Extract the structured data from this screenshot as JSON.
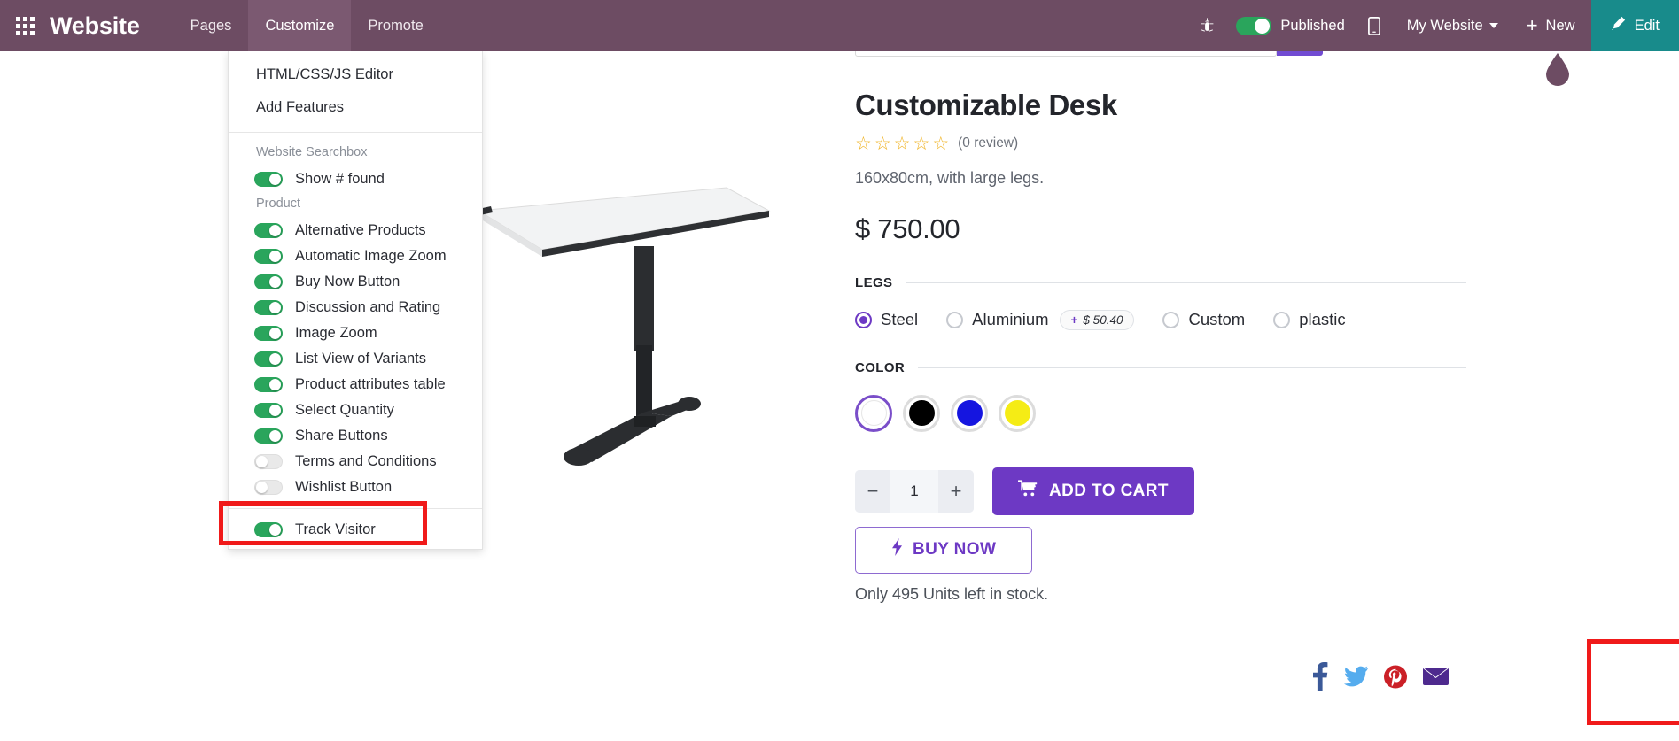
{
  "navbar": {
    "apps_icon": "apps-grid-icon",
    "brand": "Website",
    "items": [
      {
        "label": "Pages",
        "active": false
      },
      {
        "label": "Customize",
        "active": true
      },
      {
        "label": "Promote",
        "active": false
      }
    ],
    "bug_icon": "bug-icon",
    "publish": {
      "label": "Published",
      "state": "on",
      "color": "#2aa55c"
    },
    "mobile_icon": "mobile-preview-icon",
    "my_website": "My Website",
    "new_label": "New",
    "edit_label": "Edit",
    "bg_color": "#6d4c63",
    "edit_bg_color": "#188b8b"
  },
  "dropdown": {
    "links": [
      {
        "label": "HTML/CSS/JS Editor"
      },
      {
        "label": "Add Features"
      }
    ],
    "groups": [
      {
        "heading": "Website Searchbox",
        "options": [
          {
            "label": "Show # found",
            "on": true
          }
        ]
      },
      {
        "heading": "Product",
        "options": [
          {
            "label": "Alternative Products",
            "on": true
          },
          {
            "label": "Automatic Image Zoom",
            "on": true
          },
          {
            "label": "Buy Now Button",
            "on": true
          },
          {
            "label": "Discussion and Rating",
            "on": true
          },
          {
            "label": "Image Zoom",
            "on": true
          },
          {
            "label": "List View of Variants",
            "on": true
          },
          {
            "label": "Product attributes table",
            "on": true
          },
          {
            "label": "Select Quantity",
            "on": true
          },
          {
            "label": "Share Buttons",
            "on": true
          },
          {
            "label": "Terms and Conditions",
            "on": false
          },
          {
            "label": "Wishlist Button",
            "on": false
          }
        ]
      },
      {
        "heading": "",
        "options": [
          {
            "label": "Track Visitor",
            "on": true
          }
        ]
      }
    ]
  },
  "product": {
    "title": "Customizable Desk",
    "stars": "☆☆☆☆☆",
    "star_count": 5,
    "star_color": "#f0b323",
    "review_count": "(0 review)",
    "subtitle": "160x80cm, with large legs.",
    "price": "$ 750.00",
    "attributes": [
      {
        "name": "LEGS",
        "type": "radio",
        "options": [
          {
            "label": "Steel",
            "selected": true,
            "extra": ""
          },
          {
            "label": "Aluminium",
            "selected": false,
            "extra": "+  $ 50.40"
          },
          {
            "label": "Custom",
            "selected": false,
            "extra": ""
          },
          {
            "label": "plastic",
            "selected": false,
            "extra": ""
          }
        ]
      },
      {
        "name": "COLOR",
        "type": "swatch",
        "options": [
          {
            "label": "White",
            "color": "#ffffff",
            "selected": true
          },
          {
            "label": "Black",
            "color": "#000000",
            "selected": false
          },
          {
            "label": "Blue",
            "color": "#1515e0",
            "selected": false
          },
          {
            "label": "Yellow",
            "color": "#f5ec15",
            "selected": false
          }
        ]
      }
    ],
    "quantity": "1",
    "qty_minus": "−",
    "qty_plus": "+",
    "add_to_cart": "ADD TO CART",
    "buy_now": "BUY NOW",
    "stock_text": "Only 495 Units left in stock.",
    "accent_color": "#6d39c4"
  },
  "social_share": [
    {
      "name": "facebook-icon",
      "color": "#3b5998"
    },
    {
      "name": "twitter-icon",
      "color": "#55acee"
    },
    {
      "name": "pinterest-icon",
      "color": "#cb2027"
    },
    {
      "name": "email-icon",
      "color": "#4e2a8e"
    }
  ],
  "annotations": [
    {
      "name": "share-buttons-highlight",
      "color": "#f01a1a"
    },
    {
      "name": "social-share-highlight",
      "color": "#f01a1a"
    }
  ]
}
